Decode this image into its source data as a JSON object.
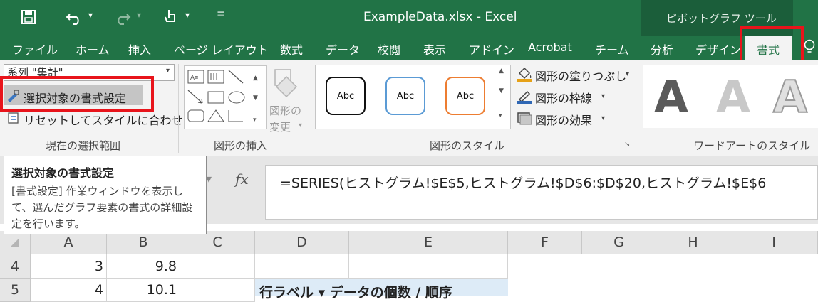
{
  "window": {
    "title": "ExampleData.xlsx - Excel",
    "context_label": "ピボットグラフ ツール"
  },
  "qat": {
    "save_icon": "save-icon",
    "undo_icon": "undo-icon",
    "redo_icon": "redo-icon",
    "touch_icon": "touch-mode-icon",
    "customize_icon": "customize-qat-icon"
  },
  "tabs": [
    "ファイル",
    "ホーム",
    "挿入",
    "ページ レイアウト",
    "数式",
    "データ",
    "校閲",
    "表示",
    "アドイン",
    "Acrobat",
    "チーム",
    "分析",
    "デザイン"
  ],
  "active_tab": "書式",
  "ribbon": {
    "current_selection": {
      "combo_value": "系列 \"集計\"",
      "format_selection": "選択対象の書式設定",
      "reset_match_style": "リセットしてスタイルに合わせる",
      "group_label": "現在の選択範囲"
    },
    "insert_shapes": {
      "change_shape_line1": "図形の",
      "change_shape_line2": "変更",
      "group_label": "図形の挿入"
    },
    "shape_styles": {
      "abc": [
        "Abc",
        "Abc",
        "Abc"
      ],
      "fill": "図形の塗りつぶし",
      "outline": "図形の枠線",
      "effects": "図形の効果",
      "group_label": "図形のスタイル"
    },
    "wordart": {
      "letter": "A",
      "group_label": "ワードアートのスタイル"
    }
  },
  "tooltip": {
    "title": "選択対象の書式設定",
    "body": "[書式設定] 作業ウィンドウを表示して、選んだグラフ要素の書式の詳細設定を行います。"
  },
  "formula_bar": {
    "fx": "fx",
    "formula": "=SERIES(ヒストグラム!$E$5,ヒストグラム!$D$6:$D$20,ヒストグラム!$E$6"
  },
  "sheet": {
    "columns": [
      "A",
      "B",
      "C",
      "D",
      "E",
      "F",
      "G",
      "H",
      "I"
    ],
    "rows": [
      {
        "num": "4",
        "a": "3",
        "b": "9.8"
      },
      {
        "num": "5",
        "a": "4",
        "b": "10.1"
      }
    ],
    "pivot_text": "行ラベル ▾ データの個数 / 順序"
  },
  "colors": {
    "excel_green": "#217346",
    "highlight_red": "#e8141b",
    "pivot_blue": "#ddebf7"
  }
}
